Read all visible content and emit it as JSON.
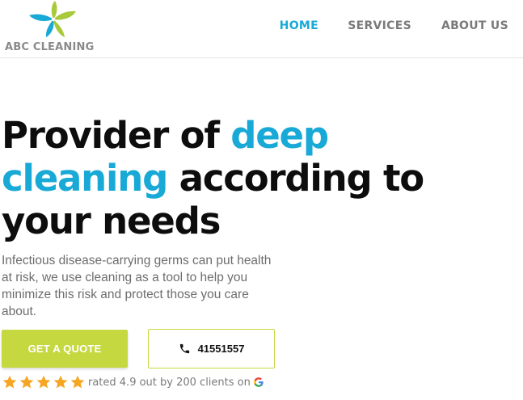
{
  "header": {
    "logo_text": "ABC CLEANING",
    "nav": [
      {
        "label": "HOME",
        "active": true
      },
      {
        "label": "SERVICES",
        "active": false
      },
      {
        "label": "ABOUT US",
        "active": false
      }
    ]
  },
  "hero": {
    "headline_part1": "Provider of ",
    "headline_accent1": "deep",
    "headline_accent2": "cleaning",
    "headline_part2": " according to your needs",
    "description": "Infectious disease-carrying germs can put health at risk, we use cleaning as a tool to help you minimize this risk and protect those you care about.",
    "cta_label": "GET A QUOTE",
    "phone_number": "41551557"
  },
  "rating": {
    "stars": 5,
    "text": "rated 4.9 out by 200 clients on",
    "source_icon": "google-icon"
  },
  "colors": {
    "accent": "#18a9d6",
    "cta": "#c6d83f",
    "star": "#f6a623",
    "text_dark": "#0d0d0d",
    "text_muted": "#6d6d6d"
  },
  "icons": {
    "logo": "flower-logo-icon",
    "phone": "phone-icon",
    "star": "star-icon"
  }
}
